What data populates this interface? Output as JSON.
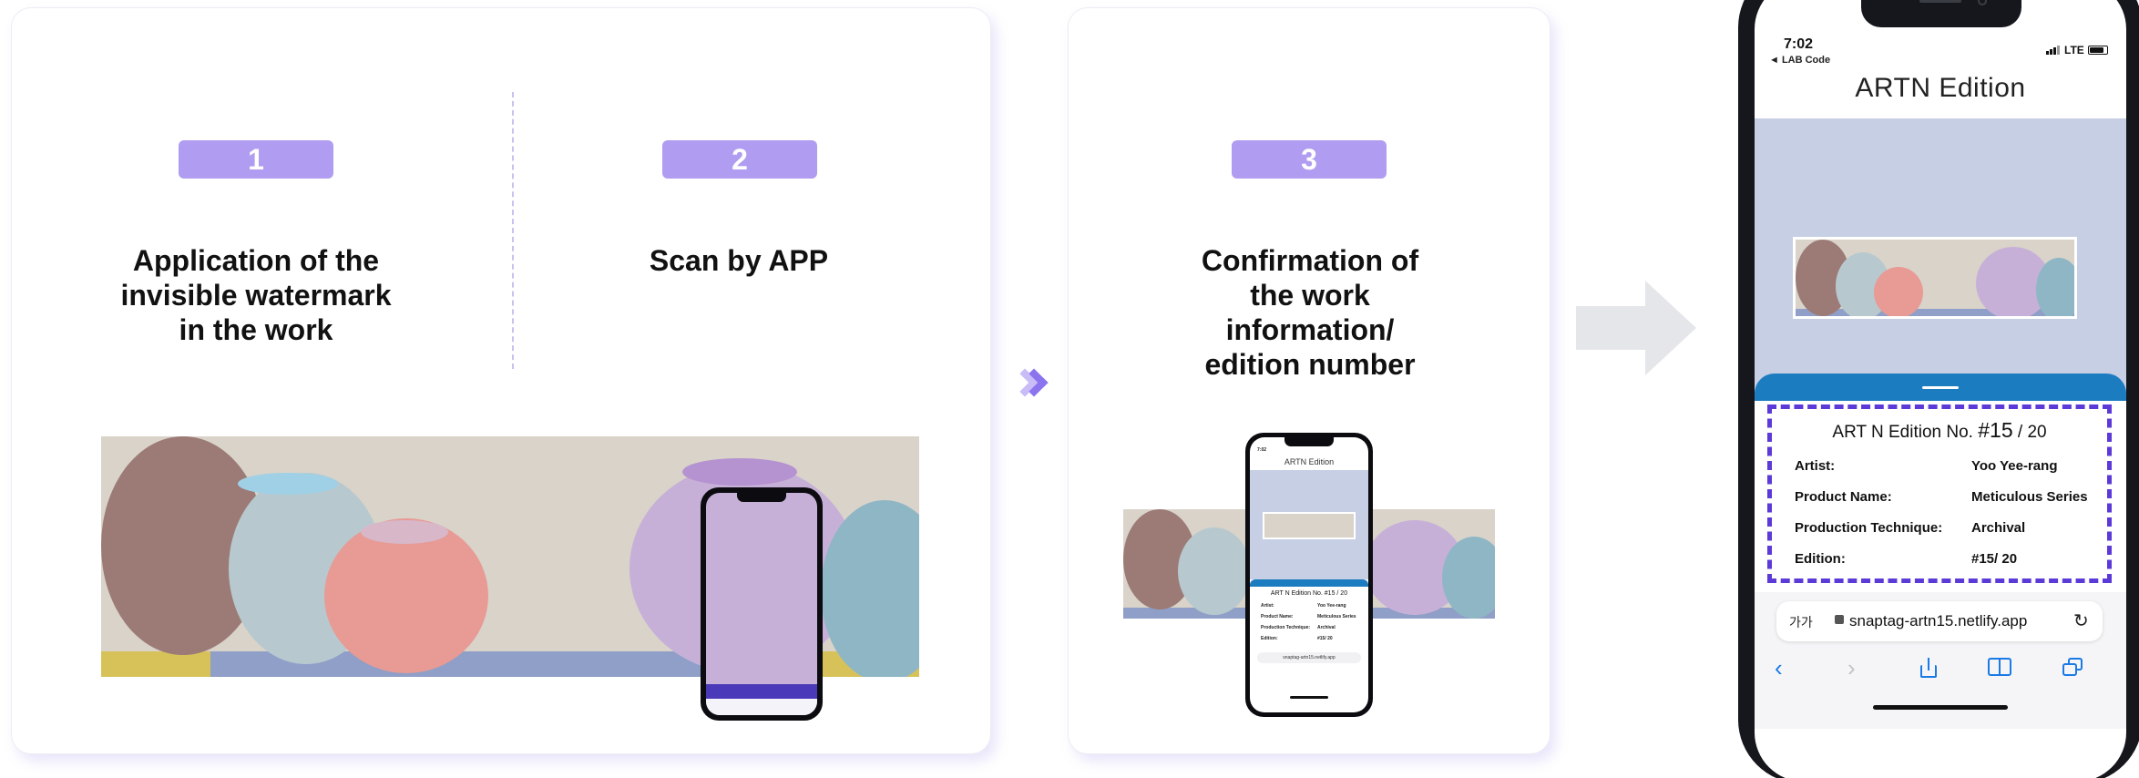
{
  "steps": [
    {
      "number": "1",
      "title": [
        "Application of the",
        "invisible watermark",
        "in the work"
      ]
    },
    {
      "number": "2",
      "title": [
        "Scan by APP"
      ]
    },
    {
      "number": "3",
      "title": [
        "Confirmation of",
        "the work",
        "information/",
        "edition number"
      ]
    }
  ],
  "phone": {
    "time": "7:02",
    "back_label": "◄ LAB Code",
    "signal": "LTE",
    "brand": "ARTN Edition",
    "edition_heading_prefix": "ART N Edition No.",
    "edition_heading_number": "#15",
    "edition_heading_total": "/ 20",
    "fields": [
      {
        "label": "Artist:",
        "value": "Yoo Yee-rang"
      },
      {
        "label": "Product Name:",
        "value": "Meticulous Series"
      },
      {
        "label": "Production Technique:",
        "value": "Archival"
      },
      {
        "label": "Edition:",
        "value": "#15/ 20"
      }
    ],
    "text_size_label": "가가",
    "url": "snaptag-artn15.netlify.app"
  },
  "mini_phone": {
    "time": "7:02",
    "brand": "ARTN Edition",
    "edition_heading": "ART N Edition No. #15 / 20",
    "fields": [
      {
        "label": "Artist:",
        "value": "Yoo Yee-rang"
      },
      {
        "label": "Product Name:",
        "value": "Meticulous Series"
      },
      {
        "label": "Production Technique:",
        "value": "Archival"
      },
      {
        "label": "Edition:",
        "value": "#15/ 20"
      }
    ],
    "url": "snaptag-artn15.netlify.app"
  },
  "colors": {
    "badge": "#b09cf0",
    "accent_blue": "#1c7cc0",
    "dashed_frame": "#5b3ad8",
    "phone_bg": "#c6cfe4",
    "arrow_purple": "#8c74ee",
    "arrow_grey": "#e4e6ea"
  }
}
